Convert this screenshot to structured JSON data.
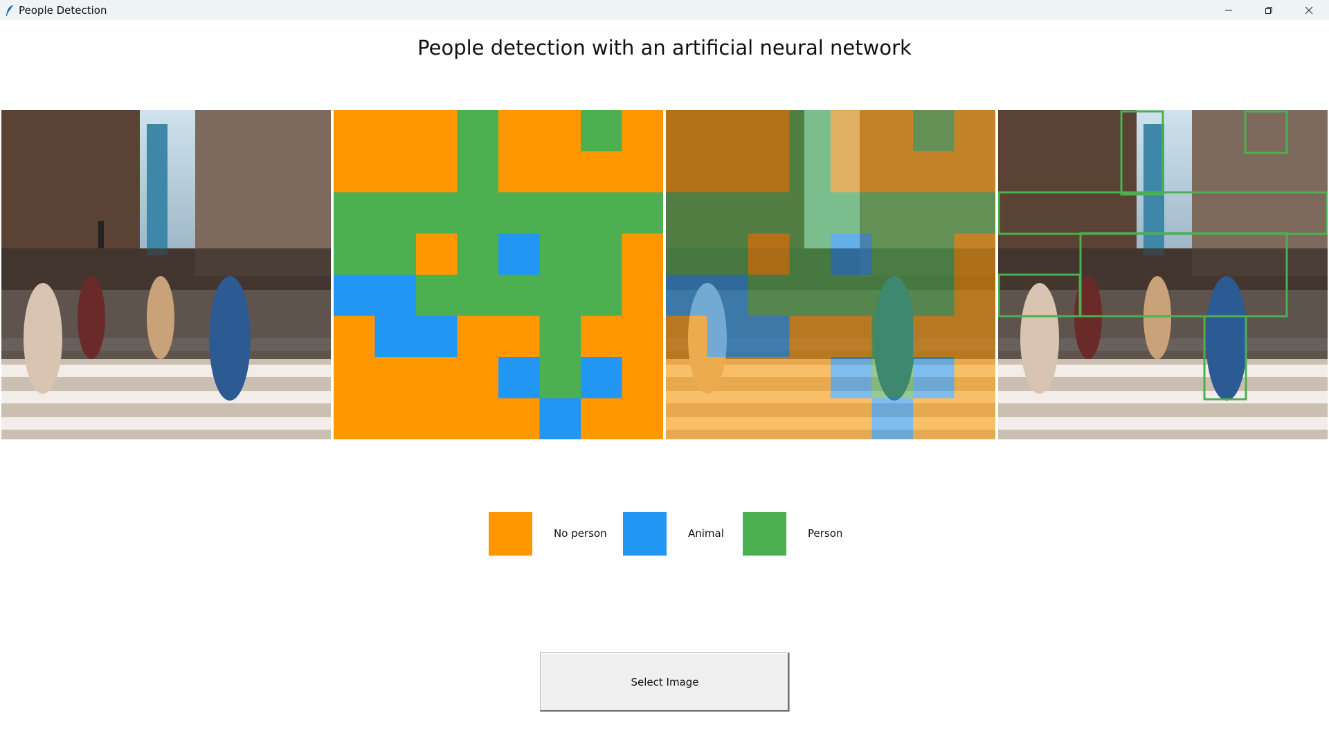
{
  "window": {
    "title": "People Detection",
    "app_icon": "feather-icon",
    "controls": [
      "minimize-icon",
      "restore-icon",
      "close-icon"
    ]
  },
  "heading": "People detection with an artificial neural network",
  "panels": [
    {
      "name": "input-image",
      "content": "street crowd photo"
    },
    {
      "name": "classification-grid",
      "content": "8x8 class grid"
    },
    {
      "name": "overlay-image",
      "content": "photo with class overlay"
    },
    {
      "name": "detection-image",
      "content": "photo with person bounding boxes"
    }
  ],
  "grid": {
    "rows": 8,
    "cols": 8,
    "cells": [
      [
        "O",
        "O",
        "O",
        "P",
        "O",
        "O",
        "P",
        "O"
      ],
      [
        "O",
        "O",
        "O",
        "P",
        "O",
        "O",
        "O",
        "O"
      ],
      [
        "P",
        "P",
        "P",
        "P",
        "P",
        "P",
        "P",
        "P"
      ],
      [
        "P",
        "P",
        "O",
        "P",
        "A",
        "P",
        "P",
        "O"
      ],
      [
        "A",
        "A",
        "P",
        "P",
        "P",
        "P",
        "P",
        "O"
      ],
      [
        "O",
        "A",
        "A",
        "O",
        "O",
        "P",
        "O",
        "O"
      ],
      [
        "O",
        "O",
        "O",
        "O",
        "A",
        "P",
        "A",
        "O"
      ],
      [
        "O",
        "O",
        "O",
        "O",
        "O",
        "A",
        "O",
        "O"
      ]
    ]
  },
  "legend": [
    {
      "label": "No person",
      "color": "#ff9800"
    },
    {
      "label": "Animal",
      "color": "#2196f3"
    },
    {
      "label": "Person",
      "color": "#4caf50"
    }
  ],
  "colors": {
    "O": "#ff9800",
    "A": "#2196f3",
    "P": "#4caf50"
  },
  "button": {
    "label": "Select Image"
  }
}
